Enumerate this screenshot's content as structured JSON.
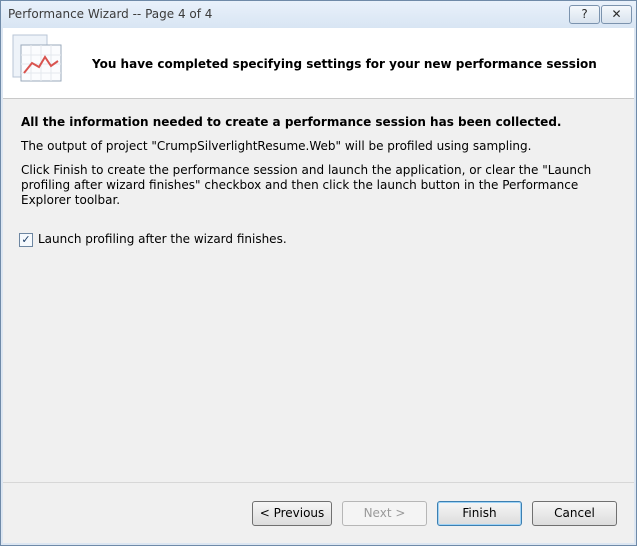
{
  "window": {
    "title": "Performance Wizard -- Page 4 of 4",
    "help_label": "?",
    "close_label": "✕"
  },
  "header": {
    "icon": "performance-chart-icon",
    "text": "You have completed specifying settings for your new performance session"
  },
  "body": {
    "title": "All the information needed to create a performance session has been collected.",
    "paragraph1": "The output of project  \"CrumpSilverlightResume.Web\" will be profiled using sampling.",
    "paragraph2": "Click Finish to create the performance session and launch the application, or clear the \"Launch profiling after wizard finishes\" checkbox and then click the launch button in the Performance Explorer toolbar."
  },
  "checkbox": {
    "checked": true,
    "mark": "✓",
    "label": "Launch profiling after the wizard finishes."
  },
  "buttons": {
    "previous": "< Previous",
    "next": "Next >",
    "finish": "Finish",
    "cancel": "Cancel"
  }
}
